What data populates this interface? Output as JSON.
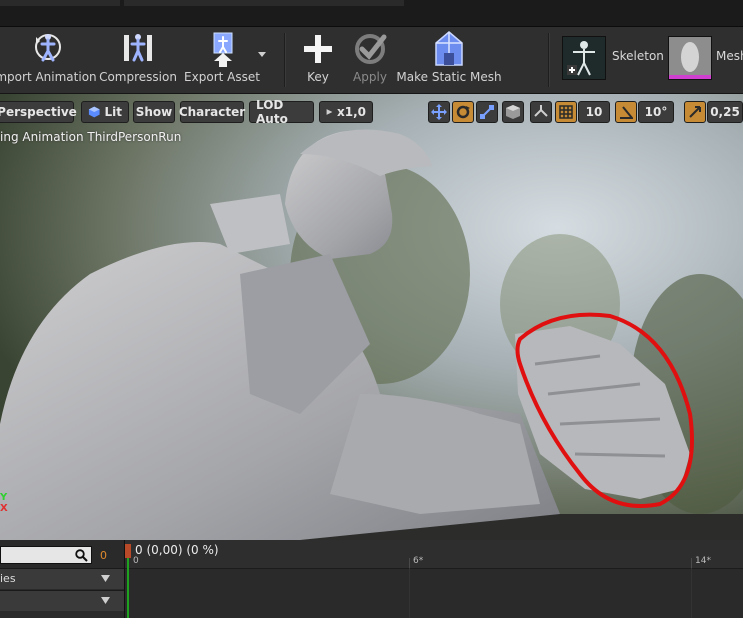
{
  "toolbar": {
    "buttons": [
      {
        "label": "mport Animation",
        "icon": "import-animation-icon"
      },
      {
        "label": "Compression",
        "icon": "compression-icon"
      },
      {
        "label": "Export Asset",
        "icon": "export-asset-icon"
      },
      {
        "label": "Key",
        "icon": "key-plus-icon"
      },
      {
        "label": "Apply",
        "icon": "apply-check-icon"
      },
      {
        "label": "Make Static Mesh",
        "icon": "make-static-mesh-icon"
      }
    ],
    "assets": [
      {
        "label": "Skeleton",
        "icon": "skeleton-icon"
      },
      {
        "label": "Mesh",
        "icon": "mesh-icon"
      }
    ]
  },
  "viewport": {
    "perspective_label": "Perspective",
    "lit_label": "Lit",
    "show_label": "Show",
    "character_label": "Character",
    "lod_label": "LOD Auto",
    "speed_label": "x1,0",
    "grid_snap_value": "10",
    "rotation_snap_value": "10°",
    "scale_snap_value": "0,25",
    "previewing_text": "ing Animation ThirdPersonRun",
    "axis_y": "Y",
    "axis_x": "X"
  },
  "timeline": {
    "current_frame": "0",
    "playhead_text": "0 (0,00) (0 %)",
    "ticks": [
      "0",
      "6*",
      "14*"
    ],
    "tracks": [
      {
        "label": "ies"
      },
      {
        "label": ""
      }
    ]
  },
  "colors": {
    "annotation_circle": "#e01010",
    "accent_orange": "#c78a35",
    "frame_number": "#e08a2c"
  }
}
